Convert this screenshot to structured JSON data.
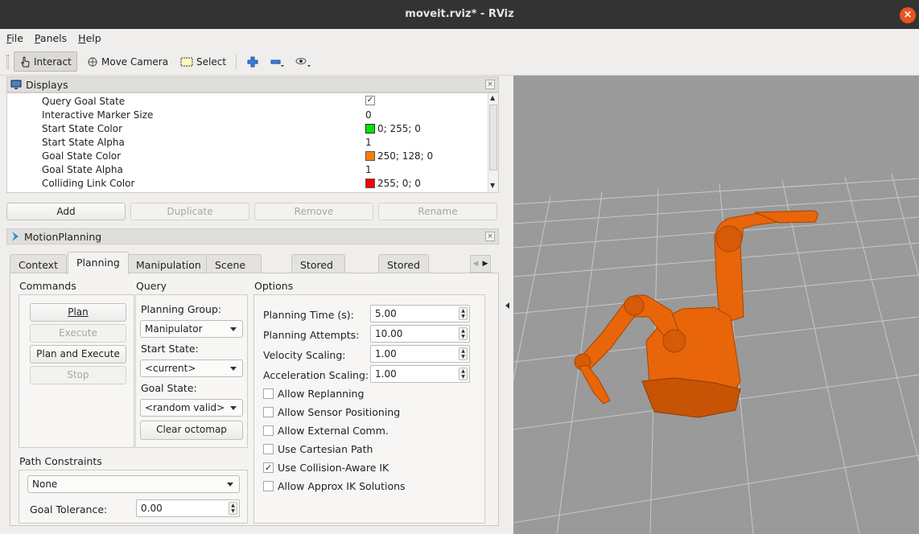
{
  "window": {
    "title": "moveit.rviz* - RViz"
  },
  "menu": [
    "File",
    "Panels",
    "Help"
  ],
  "toolbar": {
    "interact": "Interact",
    "move_camera": "Move Camera",
    "select": "Select"
  },
  "displays": {
    "title": "Displays",
    "rows": [
      {
        "key": "Query Goal State",
        "value": "✓",
        "type": "check"
      },
      {
        "key": "Interactive Marker Size",
        "value": "0"
      },
      {
        "key": "Start State Color",
        "value": "0; 255; 0",
        "color": "#00e600"
      },
      {
        "key": "Start State Alpha",
        "value": "1"
      },
      {
        "key": "Goal State Color",
        "value": "250; 128; 0",
        "color": "#fa8000"
      },
      {
        "key": "Goal State Alpha",
        "value": "1"
      },
      {
        "key": "Colliding Link Color",
        "value": "255; 0; 0",
        "color": "#ff0000"
      }
    ],
    "buttons": {
      "add": "Add",
      "duplicate": "Duplicate",
      "remove": "Remove",
      "rename": "Rename"
    }
  },
  "motion_planning": {
    "title": "MotionPlanning",
    "tabs": [
      "Context",
      "Planning",
      "Manipulation",
      "Scene Objects",
      "Stored Scenes",
      "Stored States"
    ],
    "active_tab": "Planning",
    "commands": {
      "title": "Commands",
      "plan": "Plan",
      "execute": "Execute",
      "plan_and_execute": "Plan and Execute",
      "stop": "Stop"
    },
    "query": {
      "title": "Query",
      "planning_group_label": "Planning Group:",
      "planning_group": "Manipulator",
      "start_state_label": "Start State:",
      "start_state": "<current>",
      "goal_state_label": "Goal State:",
      "goal_state": "<random valid>",
      "clear_octomap": "Clear octomap"
    },
    "options": {
      "title": "Options",
      "planning_time_label": "Planning Time (s):",
      "planning_time": "5.00",
      "planning_attempts_label": "Planning Attempts:",
      "planning_attempts": "10.00",
      "velocity_scaling_label": "Velocity Scaling:",
      "velocity_scaling": "1.00",
      "acceleration_scaling_label": "Acceleration Scaling:",
      "acceleration_scaling": "1.00",
      "checks": [
        {
          "label": "Allow Replanning",
          "checked": false
        },
        {
          "label": "Allow Sensor Positioning",
          "checked": false
        },
        {
          "label": "Allow External Comm.",
          "checked": false
        },
        {
          "label": "Use Cartesian Path",
          "checked": false
        },
        {
          "label": "Use Collision-Aware IK",
          "checked": true
        },
        {
          "label": "Allow Approx IK Solutions",
          "checked": false
        }
      ]
    },
    "path_constraints": {
      "title": "Path Constraints",
      "value": "None",
      "goal_tolerance_label": "Goal Tolerance:",
      "goal_tolerance": "0.00"
    }
  },
  "colors": {
    "accent": "#e95420",
    "robot": "#e8650a",
    "grid": "#9a9a9a"
  }
}
